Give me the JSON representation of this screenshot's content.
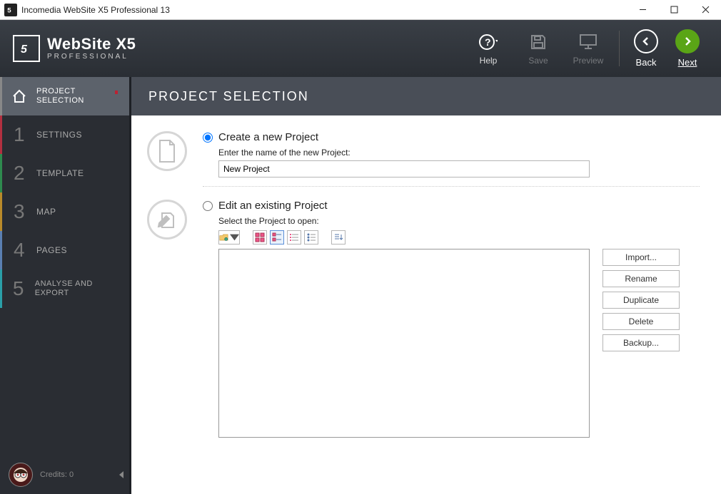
{
  "window": {
    "title": "Incomedia WebSite X5 Professional 13"
  },
  "brand": {
    "name": "WebSite X5",
    "edition": "PROFESSIONAL"
  },
  "toolbar": {
    "help": "Help",
    "save": "Save",
    "preview": "Preview",
    "back": "Back",
    "next": "Next"
  },
  "sidebar": {
    "items": [
      {
        "label": "PROJECT SELECTION"
      },
      {
        "num": "1",
        "label": "SETTINGS"
      },
      {
        "num": "2",
        "label": "TEMPLATE"
      },
      {
        "num": "3",
        "label": "MAP"
      },
      {
        "num": "4",
        "label": "PAGES"
      },
      {
        "num": "5",
        "label": "ANALYSE AND EXPORT"
      }
    ],
    "credits": "Credits: 0"
  },
  "page": {
    "title": "PROJECT SELECTION",
    "newProject": {
      "title": "Create a new Project",
      "fieldLabel": "Enter the name of the new Project:",
      "value": "New Project"
    },
    "editProject": {
      "title": "Edit an existing Project",
      "fieldLabel": "Select the Project to open:"
    },
    "actions": {
      "import": "Import...",
      "rename": "Rename",
      "duplicate": "Duplicate",
      "delete": "Delete",
      "backup": "Backup..."
    }
  }
}
